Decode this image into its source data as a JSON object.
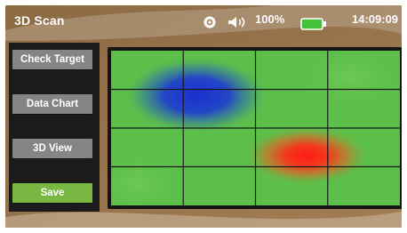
{
  "header": {
    "title": "3D Scan",
    "volume_percent": "100%",
    "time": "14:09:09",
    "icons": [
      "settings-icon",
      "speaker-icon",
      "battery-icon"
    ]
  },
  "sidebar": {
    "buttons": [
      {
        "label": "Check Target"
      },
      {
        "label": "Data Chart"
      },
      {
        "label": "3D View"
      },
      {
        "label": "Save"
      }
    ]
  },
  "scan": {
    "grid_columns": 4,
    "grid_rows": 4
  },
  "colors": {
    "accent_save": "#78b741",
    "field_green": "#5cbf4a",
    "blob_blue": "#1e3cd0",
    "blob_red": "#f02020"
  }
}
